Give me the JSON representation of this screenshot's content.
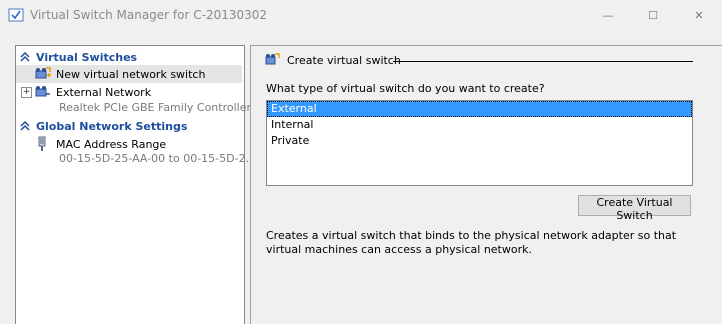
{
  "window": {
    "title": "Virtual Switch Manager for C-20130302",
    "minimize_glyph": "—",
    "maximize_glyph": "☐",
    "close_glyph": "✕"
  },
  "left_pane": {
    "virtual_switches_header": "Virtual Switches",
    "new_switch_label": "New virtual network switch",
    "external_network": {
      "expander_glyph": "+",
      "label": "External Network",
      "adapter": "Realtek PCIe GBE Family Controller"
    },
    "global_settings_header": "Global Network Settings",
    "mac_range": {
      "label": "MAC Address Range",
      "value": "00-15-5D-25-AA-00 to 00-15-5D-2..."
    }
  },
  "right_pane": {
    "header": "Create virtual switch",
    "question": "What type of virtual switch do you want to create?",
    "options": [
      "External",
      "Internal",
      "Private"
    ],
    "selected_option": "External",
    "create_button_label": "Create Virtual Switch",
    "description": "Creates a virtual switch that binds to the physical network adapter so that virtual machines can access a physical network."
  },
  "colors": {
    "section_header": "#1f4e9e",
    "selection": "#3399ff",
    "window_bg": "#f0f0f0"
  },
  "icons": [
    "switch-manager-icon",
    "collapse-chevron-icon",
    "network-switch-icon",
    "mac-address-icon"
  ]
}
